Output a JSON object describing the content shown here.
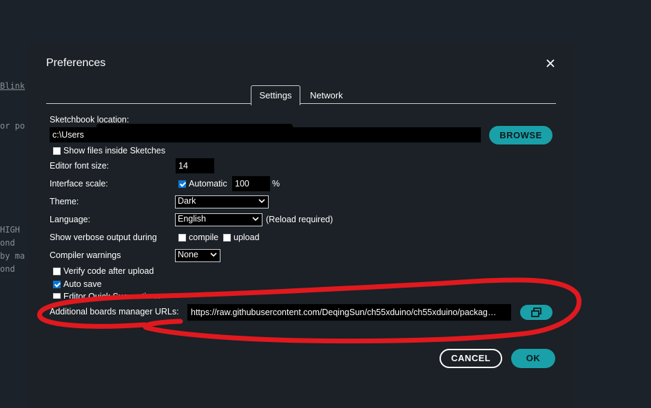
{
  "background_code": {
    "line1": "Blink",
    "line2": "or po",
    "line3": "HIGH",
    "line4": "ond",
    "line5": "by ma",
    "line6": "ond"
  },
  "dialog": {
    "title": "Preferences",
    "close_icon": "close-icon",
    "tabs": [
      {
        "label": "Settings",
        "active": true
      },
      {
        "label": "Network",
        "active": false
      }
    ]
  },
  "settings": {
    "sketchbook_label": "Sketchbook location:",
    "sketchbook_value": "c:\\Users",
    "browse_label": "BROWSE",
    "show_files_label": "Show files inside Sketches",
    "show_files_checked": false,
    "font_size_label": "Editor font size:",
    "font_size_value": "14",
    "interface_scale_label": "Interface scale:",
    "automatic_label": "Automatic",
    "automatic_checked": true,
    "scale_value": "100",
    "scale_unit": "%",
    "theme_label": "Theme:",
    "theme_value": "Dark",
    "language_label": "Language:",
    "language_value": "English",
    "language_note": "(Reload required)",
    "verbose_label": "Show verbose output during",
    "compile_label": "compile",
    "compile_checked": false,
    "upload_label": "upload",
    "upload_checked": false,
    "compiler_warnings_label": "Compiler warnings",
    "compiler_warnings_value": "None",
    "verify_label": "Verify code after upload",
    "verify_checked": false,
    "autosave_label": "Auto save",
    "autosave_checked": true,
    "quick_suggestions_label": "Editor Quick Suggestions",
    "boards_urls_label": "Additional boards manager URLs:",
    "boards_urls_value": "https://raw.githubusercontent.com/DeqingSun/ch55xduino/ch55xduino/packag…",
    "open_window_icon": "external-window-icon"
  },
  "footer": {
    "cancel_label": "CANCEL",
    "ok_label": "OK"
  },
  "colors": {
    "accent": "#1aa0a8",
    "background": "#1b2229",
    "annotation": "#e0191f",
    "checkbox": "#0a75d8"
  }
}
